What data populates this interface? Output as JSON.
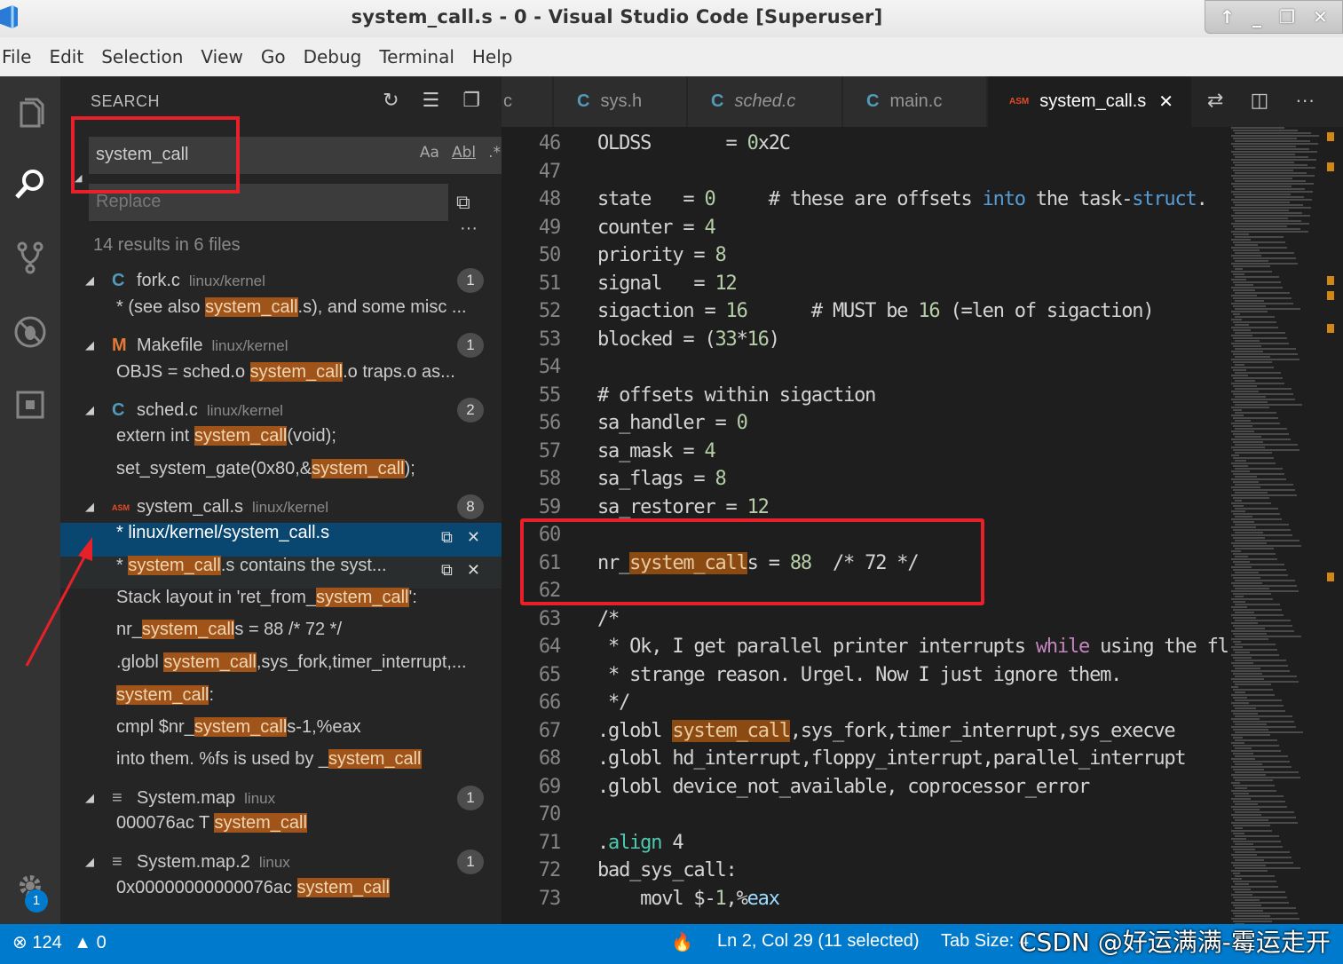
{
  "window": {
    "title": "system_call.s - 0 - Visual Studio Code [Superuser]",
    "controls": [
      "↑",
      "_",
      "❐",
      "✕"
    ]
  },
  "menu": [
    "File",
    "Edit",
    "Selection",
    "View",
    "Go",
    "Debug",
    "Terminal",
    "Help"
  ],
  "sidebar": {
    "header": "SEARCH",
    "search_value": "system_call",
    "search_options": [
      "Aa",
      "Abl",
      ".*"
    ],
    "replace_placeholder": "Replace",
    "results_summary": "14 results in 6 files",
    "files": [
      {
        "name": "fork.c",
        "path": "linux/kernel",
        "icon": "C",
        "count": "1"
      },
      {
        "name": "Makefile",
        "path": "linux/kernel",
        "icon": "M",
        "count": "1"
      },
      {
        "name": "sched.c",
        "path": "linux/kernel",
        "icon": "C",
        "count": "2"
      },
      {
        "name": "system_call.s",
        "path": "linux/kernel",
        "icon": "ASM",
        "count": "8"
      },
      {
        "name": "System.map",
        "path": "linux",
        "icon": "≡",
        "count": "1"
      },
      {
        "name": "System.map.2",
        "path": "linux",
        "icon": "≡",
        "count": "1"
      }
    ],
    "matches": [
      {
        "pre": "* (see also ",
        "hit": "system_call",
        "post": ".s), and some misc ..."
      },
      {
        "pre": "OBJS  = sched.o ",
        "hit": "system_call",
        "post": ".o traps.o as..."
      },
      {
        "pre": "extern int ",
        "hit": "system_call",
        "post": "(void);"
      },
      {
        "pre": "set_system_gate(0x80,&",
        "hit": "system_call",
        "post": ");"
      },
      {
        "pre": "* linux/kernel/",
        "hit": "system_call",
        "post": ".s"
      },
      {
        "pre": "* ",
        "hit": "system_call",
        "post": ".s  contains the syst..."
      },
      {
        "pre": "Stack layout in 'ret_from_",
        "hit": "system_call",
        "post": "':"
      },
      {
        "pre": "nr_",
        "hit": "system_call",
        "post": "s = 88  /* 72 */"
      },
      {
        "pre": ".globl ",
        "hit": "system_call",
        "post": ",sys_fork,timer_interrupt,..."
      },
      {
        "pre": "",
        "hit": "system_call",
        "post": ":"
      },
      {
        "pre": "cmpl $nr_",
        "hit": "system_call",
        "post": "s-1,%eax"
      },
      {
        "pre": "into them. %fs is used by _",
        "hit": "system_call",
        "post": ""
      },
      {
        "pre": "000076ac T ",
        "hit": "system_call",
        "post": ""
      },
      {
        "pre": "0x00000000000076ac          ",
        "hit": "system_call",
        "post": ""
      }
    ]
  },
  "tabs": [
    {
      "label": "c",
      "icon": ""
    },
    {
      "label": "sys.h",
      "icon": "C"
    },
    {
      "label": "sched.c",
      "icon": "C"
    },
    {
      "label": "main.c",
      "icon": "C"
    },
    {
      "label": "system_call.s",
      "icon": "ASM",
      "active": true
    }
  ],
  "editor": {
    "lines": [
      {
        "n": "46",
        "code": "OLDSS       = 0x2C"
      },
      {
        "n": "47",
        "code": ""
      },
      {
        "n": "48",
        "code": "state   = 0     # these are offsets into the task-struct."
      },
      {
        "n": "49",
        "code": "counter = 4"
      },
      {
        "n": "50",
        "code": "priority = 8"
      },
      {
        "n": "51",
        "code": "signal   = 12"
      },
      {
        "n": "52",
        "code": "sigaction = 16      # MUST be 16 (=len of sigaction)"
      },
      {
        "n": "53",
        "code": "blocked = (33*16)"
      },
      {
        "n": "54",
        "code": ""
      },
      {
        "n": "55",
        "code": "# offsets within sigaction"
      },
      {
        "n": "56",
        "code": "sa_handler = 0"
      },
      {
        "n": "57",
        "code": "sa_mask = 4"
      },
      {
        "n": "58",
        "code": "sa_flags = 8"
      },
      {
        "n": "59",
        "code": "sa_restorer = 12"
      },
      {
        "n": "60",
        "code": ""
      },
      {
        "n": "61",
        "code": "nr_system_calls = 88  /* 72 */"
      },
      {
        "n": "62",
        "code": ""
      },
      {
        "n": "63",
        "code": "/*"
      },
      {
        "n": "64",
        "code": " * Ok, I get parallel printer interrupts while using the flopp"
      },
      {
        "n": "65",
        "code": " * strange reason. Urgel. Now I just ignore them."
      },
      {
        "n": "66",
        "code": " */"
      },
      {
        "n": "67",
        "code": ".globl system_call,sys_fork,timer_interrupt,sys_execve"
      },
      {
        "n": "68",
        "code": ".globl hd_interrupt,floppy_interrupt,parallel_interrupt"
      },
      {
        "n": "69",
        "code": ".globl device_not_available, coprocessor_error"
      },
      {
        "n": "70",
        "code": ""
      },
      {
        "n": "71",
        "code": ".align 4"
      },
      {
        "n": "72",
        "code": "bad_sys_call:"
      },
      {
        "n": "73",
        "code": "    movl $-1,%eax"
      }
    ]
  },
  "status": {
    "errors": "124",
    "warnings": "0",
    "position": "Ln 2, Col 29 (11 selected)",
    "tab_size": "Tab Size: 4",
    "watermark": "CSDN @好运满满-霉运走开"
  },
  "colors": {
    "accent": "#007acc",
    "highlight": "#a0541a",
    "annotation": "#e8202a"
  }
}
